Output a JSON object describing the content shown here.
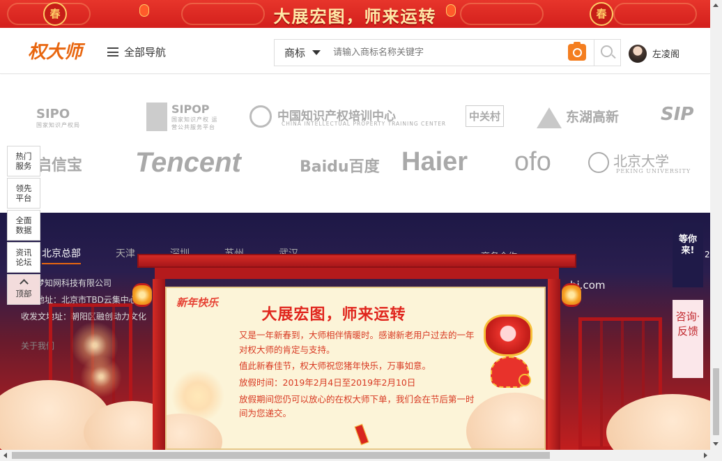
{
  "banner": {
    "title": "大展宏图，师来运转",
    "medal": "春"
  },
  "header": {
    "logo": "权大师",
    "nav_all": "全部导航",
    "search_category": "商标",
    "search_placeholder": "请输入商标名称关键字",
    "username": "左凌阁"
  },
  "partners": {
    "row1": [
      {
        "name": "SIPO",
        "sub": "国家知识产权局"
      },
      {
        "name": "SIPOP",
        "sub": "国家知识产权 运营公共服务平台"
      },
      {
        "name": "中国知识产权培训中心",
        "sub": "CHINA INTELLECTUAL PROPERTY TRAINING CENTER"
      },
      {
        "name": "中关村",
        "sub": ""
      },
      {
        "name": "东湖高新",
        "sub": ""
      },
      {
        "name": "SIP",
        "sub": ""
      }
    ],
    "row2": [
      {
        "name": "启信宝",
        "sub": ""
      },
      {
        "name": "Tencent",
        "sub": ""
      },
      {
        "name": "Baidu百度",
        "sub": ""
      },
      {
        "name": "Haier",
        "sub": ""
      },
      {
        "name": "ofo",
        "sub": ""
      },
      {
        "name": "北京大学",
        "sub": "PEKING UNIVERSITY"
      }
    ]
  },
  "left_sidebar": {
    "items": [
      "热门服务",
      "领先平台",
      "全面数据",
      "资讯论坛"
    ],
    "top_label": "顶部"
  },
  "footer": {
    "tabs": [
      "北京总部",
      "天津",
      "深圳",
      "苏州",
      "武汉"
    ],
    "right_heading": "商务合作",
    "company": "梦知网科技有限公司",
    "address": "地址：北京市TBD云集中心",
    "line3": "收发文地址：朝阳区融创动力文化",
    "links": "关于我们",
    "email_suffix": "hi.com"
  },
  "popup": {
    "tag": "新年快乐",
    "title": "大展宏图，师来运转",
    "paragraphs": [
      "又是一年新春到，大师相伴情暖时。感谢新老用户过去的一年对权大师的肯定与支持。",
      "值此新春佳节，权大师祝您猪年快乐，万事如意。",
      "放假时间：2019年2月4日至2019年2月10日",
      "放假期间您仍可以放心的在权大师下单，我们会在节后第一时间为您递交。"
    ]
  },
  "right_tabs": {
    "wait": "等你来!",
    "consult": "咨询·反馈",
    "num": "2"
  },
  "colors": {
    "brand_orange": "#e8660f",
    "banner_red": "#d31f1c",
    "popup_text": "#d83a23"
  }
}
